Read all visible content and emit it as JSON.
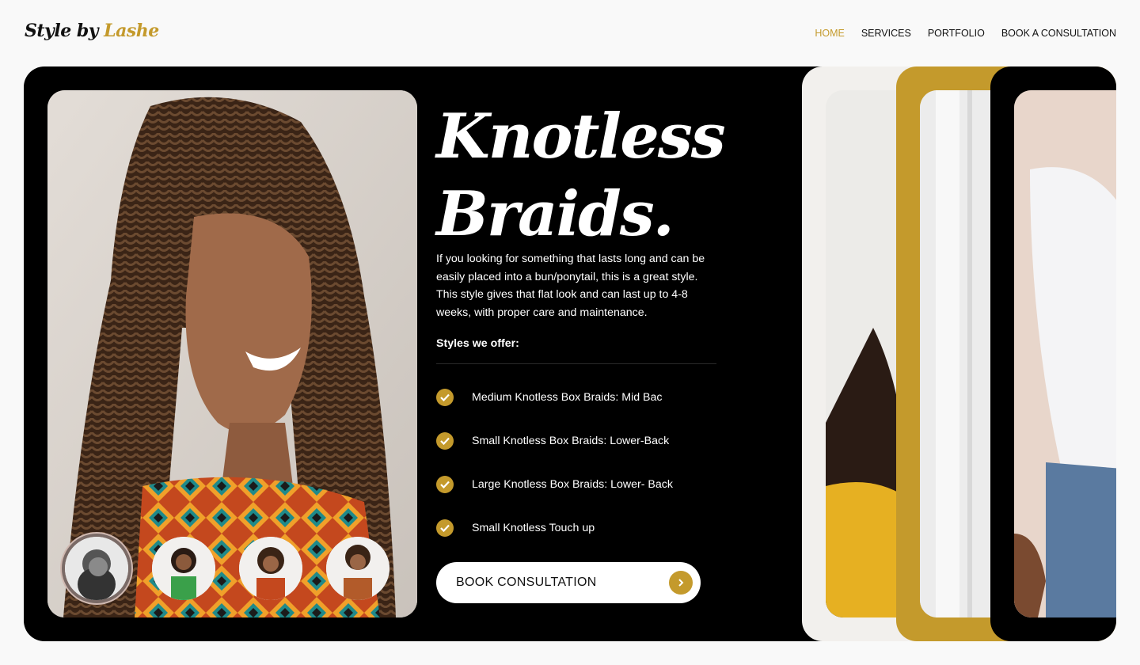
{
  "brand": {
    "name_part1": "Style by ",
    "name_part2": "Lashe",
    "accent_color": "#c49a2c"
  },
  "nav": {
    "items": [
      {
        "label": "HOME",
        "active": true
      },
      {
        "label": "SERVICES",
        "active": false
      },
      {
        "label": "PORTFOLIO",
        "active": false
      },
      {
        "label": "BOOK A CONSULTATION",
        "active": false
      }
    ]
  },
  "hero": {
    "title_line1": "Knotless",
    "title_line2": "Braids.",
    "description": "If you looking for something that lasts long and can be easily placed into a bun/ponytail, this is a great style. This style gives that flat look and can last up to 4-8 weeks, with proper care and maintenance.",
    "styles_heading": "Styles we offer:",
    "styles": [
      "Medium Knotless Box Braids: Mid Bac",
      "Small Knotless Box Braids: Lower-Back",
      "Large Knotless Box Braids: Lower- Back",
      "Small Knotless Touch up"
    ],
    "cta_label": "BOOK CONSULTATION",
    "image_icon": "portrait-photo",
    "thumbnail_count": 4
  },
  "side_cards": {
    "colors": [
      "#f2f0ed",
      "#c49a2c",
      "#000000"
    ]
  }
}
